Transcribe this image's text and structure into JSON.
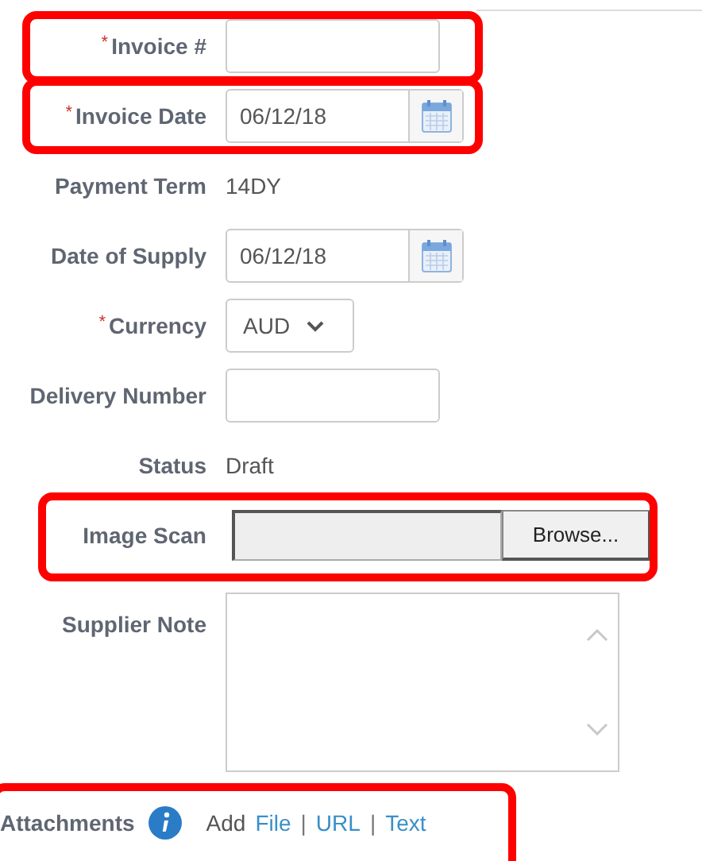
{
  "fields": [
    {
      "kind": "text",
      "label": "Invoice #",
      "marker": "*",
      "highlighted": true
    },
    {
      "kind": "date",
      "label": "Invoice Date",
      "marker": "*",
      "highlighted": true,
      "value": "06/12/18"
    },
    {
      "kind": "static",
      "label": "Payment Term",
      "highlighted": false,
      "value": "14DY"
    },
    {
      "kind": "date",
      "label": "Date of Supply",
      "highlighted": false,
      "value": "06/12/18"
    },
    {
      "kind": "select",
      "label": "Currency",
      "marker": "*",
      "highlighted": false,
      "value": "AUD"
    },
    {
      "kind": "text",
      "label": "Delivery Number",
      "highlighted": false
    },
    {
      "kind": "static",
      "label": "Status",
      "highlighted": false,
      "value": "Draft"
    },
    {
      "kind": "file",
      "label": "Image Scan",
      "highlighted": true,
      "button": "Browse..."
    },
    {
      "kind": "textarea",
      "label": "Supplier Note",
      "highlighted": false
    }
  ],
  "attachments": {
    "label": "Attachments",
    "highlighted": true,
    "prefix": "Add",
    "links": [
      "File",
      "URL",
      "Text"
    ],
    "separators": [
      "|",
      "|"
    ]
  }
}
